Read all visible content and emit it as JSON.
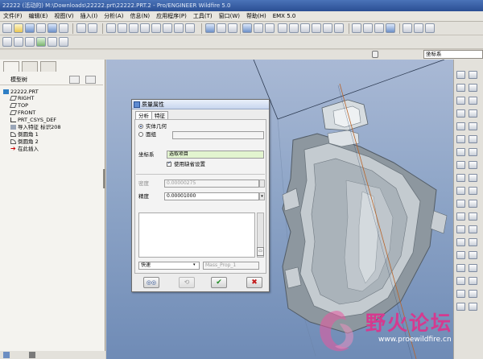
{
  "window": {
    "title": "22222 (活动的) M:\\Downloads\\22222.prt\\22222.PRT.2 - Pro/ENGINEER Wildfire 5.0"
  },
  "menu": [
    "文件(F)",
    "编辑(E)",
    "视图(V)",
    "插入(I)",
    "分析(A)",
    "信息(N)",
    "应用程序(P)",
    "工具(T)",
    "窗口(W)",
    "帮助(H)",
    "EMX 5.0"
  ],
  "toolbar": {
    "coord_select": "坐标系",
    "filter_icon": "filter-icon"
  },
  "nav": {
    "header": "模型树",
    "items": [
      "22222.PRT",
      "RIGHT",
      "TOP",
      "FRONT",
      "PRT_CSYS_DEF",
      "导入特征 标识208",
      "倒圆角 1",
      "倒圆角 2",
      "在此插入"
    ]
  },
  "dialog": {
    "title": "质量属性",
    "tab_analysis": "分析",
    "tab_feature": "特征",
    "radio_solid": "实体几何",
    "radio_quilt": "面组",
    "coord_label": "坐标系",
    "coord_value": "选取项目",
    "checkbox_default": "使用缺省设置",
    "density_label": "密度",
    "density_value": "0.00000275",
    "accuracy_label": "精度",
    "accuracy_value": "0.00001000",
    "mode_value": "快速",
    "name_value": "Mass_Prop_1",
    "ok_icon": "check-icon",
    "cancel_icon": "close-icon",
    "preview_icon": "glasses-icon",
    "repeat_icon": "repeat-icon"
  },
  "watermark": {
    "title": "野火论坛",
    "url": "www.proewildfire.cn"
  },
  "colors": {
    "titlebar": "#2b4f94",
    "viewport_top": "#a9b9d5",
    "viewport_bottom": "#6f8bb6",
    "coord_field": "#e2f4cf",
    "watermark": "#d53a8f"
  }
}
